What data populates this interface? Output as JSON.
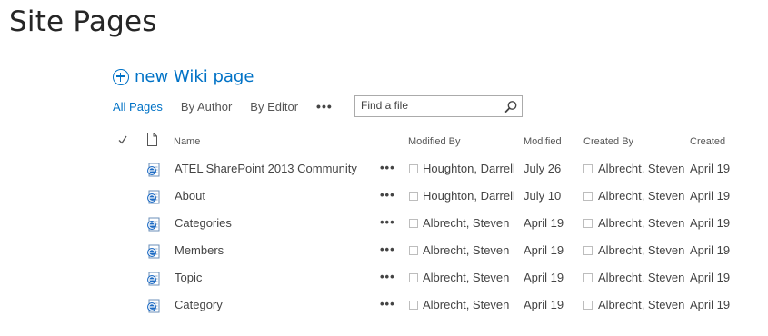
{
  "page": {
    "title": "Site Pages"
  },
  "toolbar": {
    "new_label": "new Wiki page"
  },
  "views": {
    "items": [
      "All Pages",
      "By Author",
      "By Editor"
    ],
    "active": "All Pages",
    "more_label": "•••"
  },
  "search": {
    "placeholder": "Find a file"
  },
  "columns": {
    "name": "Name",
    "modified_by": "Modified By",
    "modified": "Modified",
    "created_by": "Created By",
    "created": "Created"
  },
  "rows": [
    {
      "name": "ATEL SharePoint 2013 Community",
      "modified_by": "Houghton, Darrell",
      "modified": "July 26",
      "created_by": "Albrecht, Steven",
      "created": "April 19"
    },
    {
      "name": "About",
      "modified_by": "Houghton, Darrell",
      "modified": "July 10",
      "created_by": "Albrecht, Steven",
      "created": "April 19"
    },
    {
      "name": "Categories",
      "modified_by": "Albrecht, Steven",
      "modified": "April 19",
      "created_by": "Albrecht, Steven",
      "created": "April 19"
    },
    {
      "name": "Members",
      "modified_by": "Albrecht, Steven",
      "modified": "April 19",
      "created_by": "Albrecht, Steven",
      "created": "April 19"
    },
    {
      "name": "Topic",
      "modified_by": "Albrecht, Steven",
      "modified": "April 19",
      "created_by": "Albrecht, Steven",
      "created": "April 19"
    },
    {
      "name": "Category",
      "modified_by": "Albrecht, Steven",
      "modified": "April 19",
      "created_by": "Albrecht, Steven",
      "created": "April 19"
    }
  ],
  "row_menu_label": "•••",
  "icons": {
    "new": "plus-circle-icon",
    "search": "search-icon",
    "select_all": "check-icon",
    "type": "document-icon",
    "row": "wiki-page-icon"
  },
  "colors": {
    "accent": "#0072c6",
    "text": "#444444",
    "title": "#262626"
  }
}
